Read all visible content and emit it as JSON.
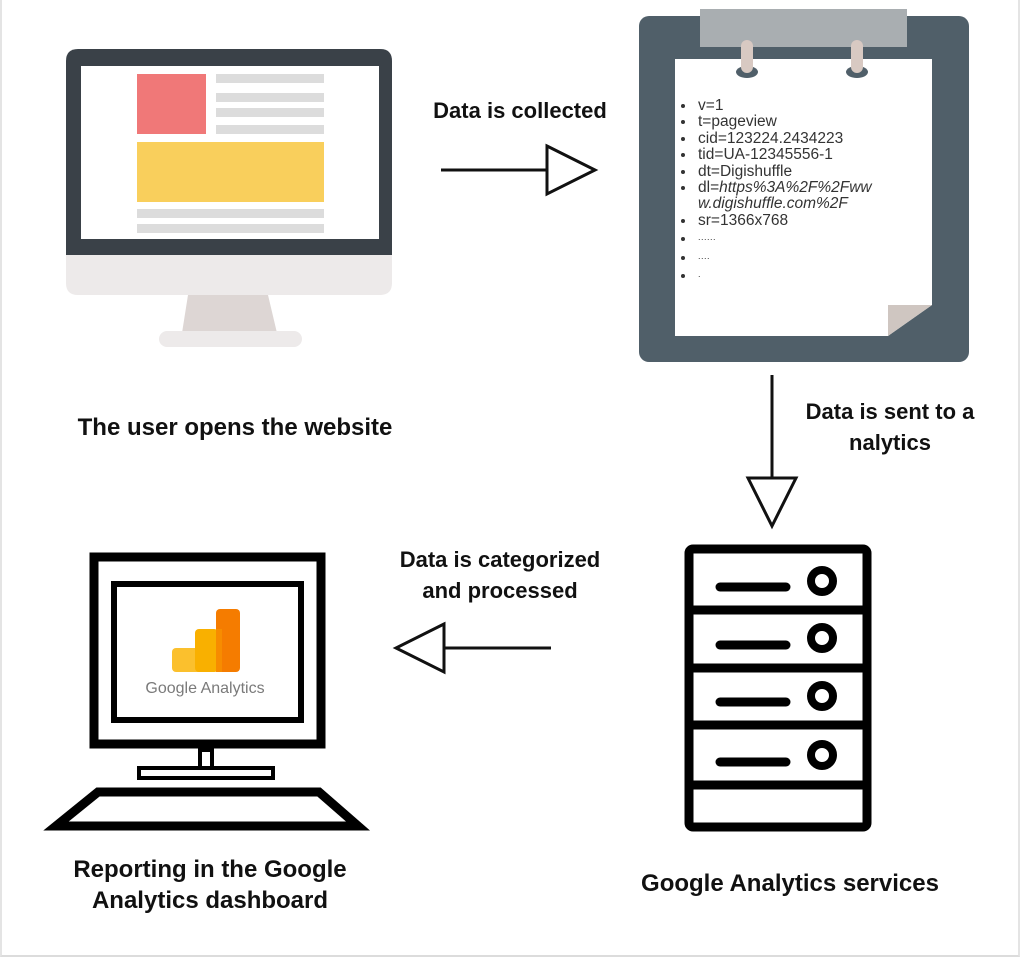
{
  "steps": {
    "user_opens": "The user opens the website",
    "data_collected": "Data is collected",
    "data_sent_line1": "Data is sent to a",
    "data_sent_line2": "nalytics",
    "data_categorized_line1": "Data is categorized",
    "data_categorized_line2": "and processed",
    "reporting_line1": "Reporting in the Google",
    "reporting_line2": "Analytics dashboard",
    "services": "Google Analytics services"
  },
  "clipboard": {
    "items": [
      {
        "key": "v=",
        "value": "1",
        "italic": false
      },
      {
        "key": "t=",
        "value": "pageview",
        "italic": false
      },
      {
        "key": "cid=",
        "value": "123224.2434223",
        "italic": false
      },
      {
        "key": "tid=",
        "value": "UA-12345556-1",
        "italic": false
      },
      {
        "key": "dt=",
        "value": "Digishuffle",
        "italic": false
      },
      {
        "key": "dl=",
        "value": "https%3A%2F%2Fww",
        "value_cont": "w.digishuffle.com%2F",
        "italic": true
      },
      {
        "key": "sr=",
        "value": "1366x768",
        "italic": false
      },
      {
        "key": "",
        "value": "......",
        "italic": false
      },
      {
        "key": "",
        "value": "....",
        "italic": false
      },
      {
        "key": "",
        "value": ".",
        "italic": false
      }
    ]
  },
  "dashboard": {
    "logo_text": "Google Analytics"
  },
  "icons": {
    "website_monitor": "desktop-monitor-icon",
    "clipboard": "clipboard-icon",
    "server": "server-rack-icon",
    "dashboard_computer": "computer-keyboard-icon",
    "analytics_logo": "google-analytics-logo"
  },
  "colors": {
    "monitor_bezel": "#3a4148",
    "monitor_chin": "#edeaea",
    "stand": "#ddd6d4",
    "red_block": "#f07878",
    "yellow_block": "#f9cf5c",
    "grey_lines": "#dcdcdc",
    "clipboard_board": "#505f69",
    "clipboard_clip": "#a9aeb1",
    "ring": "#d8c9c2",
    "ga_yellow": "#fbc02d",
    "ga_orange": "#f9a825",
    "ga_dark_orange": "#f57c00"
  }
}
